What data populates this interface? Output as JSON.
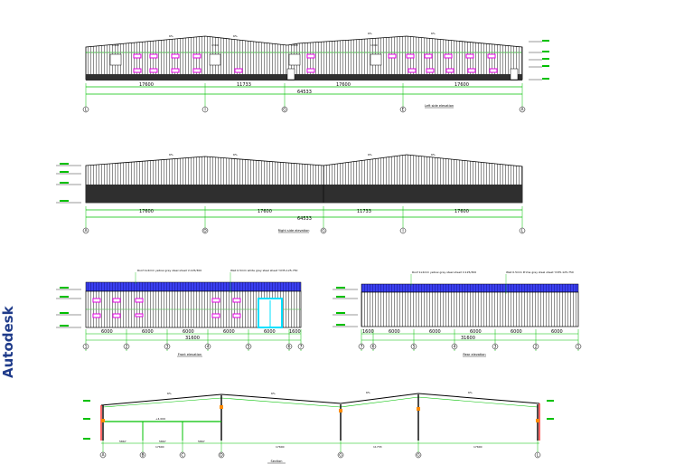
{
  "watermark": "Autodesk",
  "slopes": {
    "a": "6%",
    "b": "6%"
  },
  "left_elevation": {
    "caption": "Left side elevation",
    "overall": "64533",
    "spans": [
      "17600",
      "11733",
      "17600",
      "17600"
    ],
    "axes": [
      "L",
      "I",
      "G",
      "E",
      "A"
    ],
    "notes": [
      "1300",
      "1300",
      "1300",
      "1300"
    ],
    "vtext": "LOUVER 1300"
  },
  "right_elevation": {
    "caption": "Right side elevation",
    "overall": "64533",
    "spans": [
      "17600",
      "17600",
      "11733",
      "17600"
    ],
    "axes": [
      "A",
      "D",
      "G",
      "I",
      "L"
    ]
  },
  "front_elevation": {
    "caption": "Front elevation",
    "overall": "31600",
    "spans": [
      "6000",
      "6000",
      "6000",
      "6000",
      "6000",
      "1600"
    ],
    "axes": [
      "1",
      "2",
      "3",
      "4",
      "5",
      "6",
      "7"
    ],
    "note1": "Roof 1x2mm yellow grey steel sheet V-125/300",
    "note2": "Wall 0.5mm white grey steel sheet YX35-125-750"
  },
  "rear_elevation": {
    "caption": "Rear elevation",
    "overall": "31600",
    "spans": [
      "1600",
      "6000",
      "6000",
      "6000",
      "6000",
      "6000"
    ],
    "axes": [
      "7",
      "6",
      "5",
      "4",
      "3",
      "2",
      "1"
    ],
    "note1": "Roof 1x2mm yellow grey steel sheet V-125/300",
    "note2": "Wall 0.5mm Prima grey steel sheet YX35-125-750"
  },
  "section": {
    "caption": "Section",
    "slopes": [
      "6%",
      "6%",
      "6%",
      "6%"
    ],
    "spans_small": [
      "5867",
      "5867",
      "5867"
    ],
    "spans": [
      "17600",
      "17600",
      "11733",
      "17600"
    ],
    "axes": [
      "A",
      "B",
      "C",
      "D",
      "G",
      "G",
      "L"
    ],
    "mezz": "+4.000"
  },
  "colors": {
    "roof_blue": "#2a2fd6",
    "green": "#00c000",
    "magenta": "#e000e0",
    "cyan": "#00e0ff",
    "dark": "#2a2a2a",
    "red": "#ff0000"
  }
}
